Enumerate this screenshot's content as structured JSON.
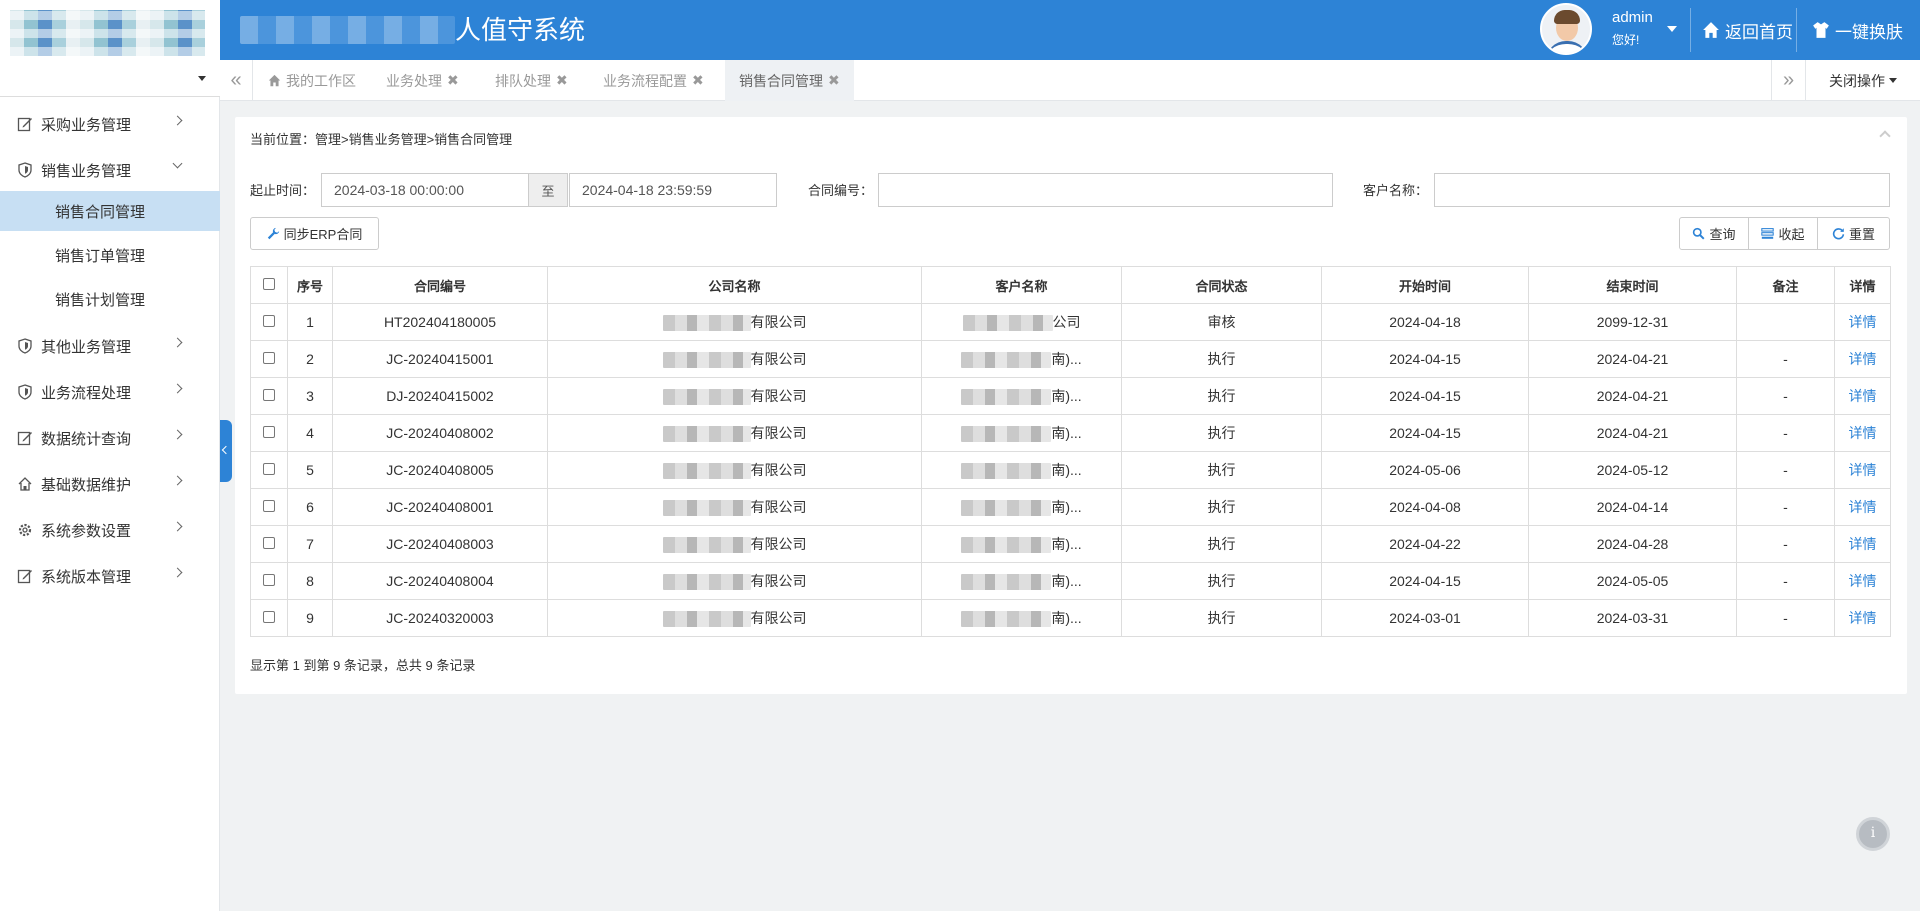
{
  "header": {
    "title": "人值守系统",
    "user_name": "admin",
    "user_greeting": "您好!",
    "home_label": "返回首页",
    "skin_label": "一键换肤",
    "color": "#2d83d6"
  },
  "sidebar": {
    "items": [
      {
        "label": "采购业务管理",
        "icon": "edit-icon"
      },
      {
        "label": "销售业务管理",
        "icon": "shield-icon",
        "expanded": true
      },
      {
        "label": "其他业务管理",
        "icon": "shield-icon"
      },
      {
        "label": "业务流程处理",
        "icon": "shield-icon"
      },
      {
        "label": "数据统计查询",
        "icon": "edit-icon"
      },
      {
        "label": "基础数据维护",
        "icon": "home-icon"
      },
      {
        "label": "系统参数设置",
        "icon": "gear-icon"
      },
      {
        "label": "系统版本管理",
        "icon": "edit-icon"
      }
    ],
    "sub_items": [
      {
        "label": "销售合同管理",
        "active": true
      },
      {
        "label": "销售订单管理"
      },
      {
        "label": "销售计划管理"
      }
    ]
  },
  "tabs": [
    {
      "label": "我的工作区",
      "icon": "home-icon"
    },
    {
      "label": "业务处理"
    },
    {
      "label": "排队处理"
    },
    {
      "label": "业务流程配置"
    },
    {
      "label": "销售合同管理",
      "active": true
    }
  ],
  "tab_ops": {
    "close_label": "关闭操作"
  },
  "breadcrumb": "当前位置：管理>销售业务管理>销售合同管理",
  "filters": {
    "time_label": "起止时间：",
    "start_time": "2024-03-18 00:00:00",
    "to_label": "至",
    "end_time": "2024-04-18 23:59:59",
    "contract_no_label": "合同编号：",
    "contract_no_value": "",
    "customer_label": "客户名称：",
    "customer_value": ""
  },
  "buttons": {
    "sync": "同步ERP合同",
    "query": "查询",
    "collapse": "收起",
    "reset": "重置"
  },
  "table": {
    "columns": [
      "序号",
      "合同编号",
      "公司名称",
      "客户名称",
      "合同状态",
      "开始时间",
      "结束时间",
      "备注",
      "详情"
    ],
    "rows": [
      {
        "no": "1",
        "contract": "HT202404180005",
        "company": "有限公司",
        "customer": "公司",
        "status": "审核",
        "start": "2024-04-18",
        "end": "2099-12-31",
        "remark": "",
        "detail": "详情"
      },
      {
        "no": "2",
        "contract": "JC-20240415001",
        "company": "有限公司",
        "customer": "南)...",
        "status": "执行",
        "start": "2024-04-15",
        "end": "2024-04-21",
        "remark": "-",
        "detail": "详情"
      },
      {
        "no": "3",
        "contract": "DJ-20240415002",
        "company": "有限公司",
        "customer": "南)...",
        "status": "执行",
        "start": "2024-04-15",
        "end": "2024-04-21",
        "remark": "-",
        "detail": "详情"
      },
      {
        "no": "4",
        "contract": "JC-20240408002",
        "company": "有限公司",
        "customer": "南)...",
        "status": "执行",
        "start": "2024-04-15",
        "end": "2024-04-21",
        "remark": "-",
        "detail": "详情"
      },
      {
        "no": "5",
        "contract": "JC-20240408005",
        "company": "有限公司",
        "customer": "南)...",
        "status": "执行",
        "start": "2024-05-06",
        "end": "2024-05-12",
        "remark": "-",
        "detail": "详情"
      },
      {
        "no": "6",
        "contract": "JC-20240408001",
        "company": "有限公司",
        "customer": "南)...",
        "status": "执行",
        "start": "2024-04-08",
        "end": "2024-04-14",
        "remark": "-",
        "detail": "详情"
      },
      {
        "no": "7",
        "contract": "JC-20240408003",
        "company": "有限公司",
        "customer": "南)...",
        "status": "执行",
        "start": "2024-04-22",
        "end": "2024-04-28",
        "remark": "-",
        "detail": "详情"
      },
      {
        "no": "8",
        "contract": "JC-20240408004",
        "company": "有限公司",
        "customer": "南)...",
        "status": "执行",
        "start": "2024-04-15",
        "end": "2024-05-05",
        "remark": "-",
        "detail": "详情"
      },
      {
        "no": "9",
        "contract": "JC-20240320003",
        "company": "有限公司",
        "customer": "南)...",
        "status": "执行",
        "start": "2024-03-01",
        "end": "2024-03-31",
        "remark": "-",
        "detail": "详情"
      }
    ]
  },
  "pager": {
    "info": "显示第 1 到第 9 条记录，总共 9 条记录"
  }
}
